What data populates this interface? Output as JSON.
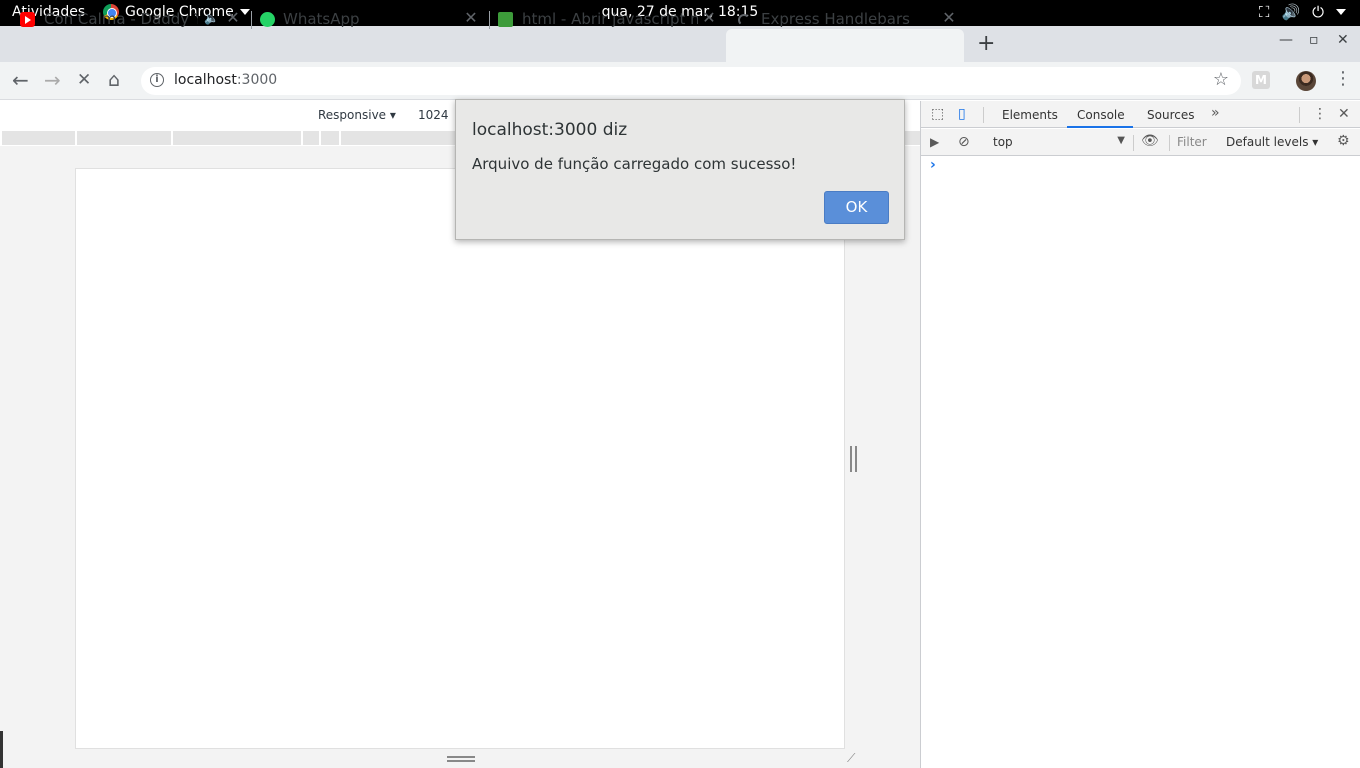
{
  "system": {
    "activities": "Atividades",
    "app_name": "Google Chrome",
    "clock": "qua, 27 de mar, 18:15"
  },
  "tabs": [
    {
      "title": "Con Calma - Daddy Yan",
      "favicon": "youtube-icon",
      "muted": true
    },
    {
      "title": "WhatsApp",
      "favicon": "whatsapp-icon"
    },
    {
      "title": "html - Abrir javascript no ha",
      "favicon": "stackoverflow-icon"
    },
    {
      "title": "Express Handlebars",
      "favicon": "loading-spinner-icon",
      "active": true
    }
  ],
  "toolbar": {
    "url_host": "localhost",
    "url_port": ":3000",
    "ext_label": "M"
  },
  "device_toolbar": {
    "mode": "Responsive ▾",
    "width": "1024"
  },
  "devtools": {
    "tabs": [
      "Elements",
      "Console",
      "Sources"
    ],
    "active_tab": "Console",
    "context": "top",
    "filter_placeholder": "Filter",
    "levels": "Default levels ▾",
    "prompt": "›"
  },
  "dialog": {
    "title": "localhost:3000 diz",
    "message": "Arquivo de função carregado com sucesso!",
    "ok_label": "OK"
  },
  "colors": {
    "accent": "#1a73e8",
    "ok_button": "#5a8fd9",
    "dialog_bg": "#e8e8e7"
  }
}
